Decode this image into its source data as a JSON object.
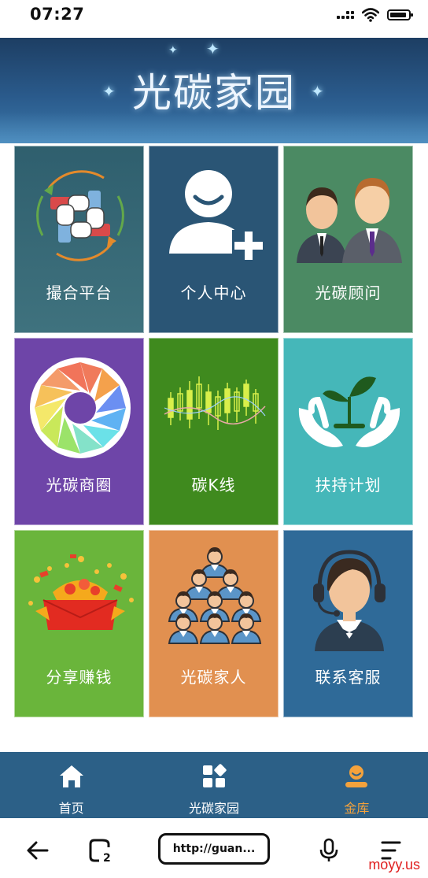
{
  "status_bar": {
    "time": "07:27"
  },
  "header": {
    "title": "光碳家园"
  },
  "tiles": [
    {
      "label": "撮合平台",
      "icon": "handshake-icon",
      "color": "#3b6b7a"
    },
    {
      "label": "个人中心",
      "icon": "add-user-icon",
      "color": "#2a5575"
    },
    {
      "label": "光碳顾问",
      "icon": "advisors-icon",
      "color": "#4b8a63"
    },
    {
      "label": "光碳商圈",
      "icon": "aperture-icon",
      "color": "#6e45a8"
    },
    {
      "label": "碳K线",
      "icon": "candlestick-chart-icon",
      "color": "#3f8a1e"
    },
    {
      "label": "扶持计划",
      "icon": "sprout-hands-icon",
      "color": "#45b7b9"
    },
    {
      "label": "分享赚钱",
      "icon": "red-envelope-icon",
      "color": "#6ab53b"
    },
    {
      "label": "光碳家人",
      "icon": "family-group-icon",
      "color": "#e19050"
    },
    {
      "label": "联系客服",
      "icon": "customer-service-icon",
      "color": "#2f6a98"
    }
  ],
  "tabbar": {
    "items": [
      {
        "label": "首页",
        "icon": "home-icon"
      },
      {
        "label": "光碳家园",
        "icon": "apps-icon"
      },
      {
        "label": "金库",
        "icon": "vault-user-icon",
        "active": true
      }
    ],
    "active_color": "#f4a23c"
  },
  "browser": {
    "url": "http://guan..."
  },
  "watermark": "moyy.us"
}
